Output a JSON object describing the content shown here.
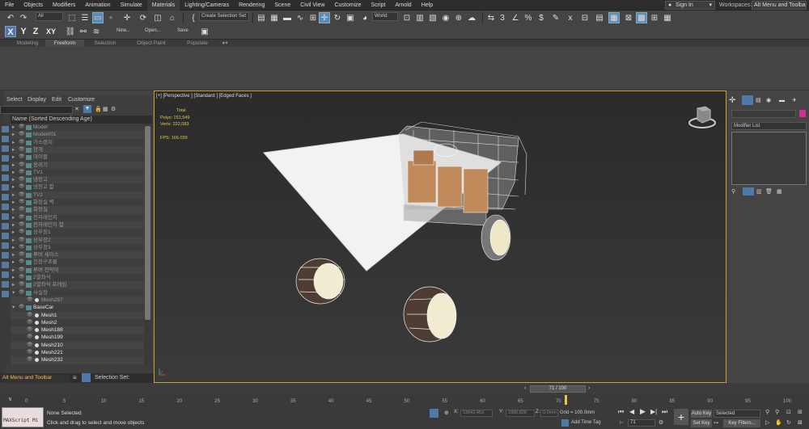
{
  "menubar": {
    "items": [
      "File",
      "Objects",
      "Modifiers",
      "Animation",
      "Simulate",
      "Materials",
      "Lighting/Cameras",
      "Rendering",
      "Scene",
      "Civil View",
      "Customize",
      "Script",
      "Arnold",
      "Help"
    ],
    "signin": "Sign In",
    "workspaces_label": "Workspaces:",
    "workspace_value": "Alt Menu and Toolbar"
  },
  "toolbar": {
    "filter": "All",
    "selection_set": "Create Selection Set",
    "coord_system": "World"
  },
  "toolbar2": {
    "axes": [
      "X",
      "Y",
      "Z",
      "XY"
    ],
    "new_label": "New...",
    "open_label": "Open...",
    "save_label": "Save"
  },
  "ribbon": {
    "tabs": [
      "Modeling",
      "Freeform",
      "Selection",
      "Object Paint",
      "Populate"
    ]
  },
  "explorer": {
    "menu": [
      "Select",
      "Display",
      "Edit",
      "Customize"
    ],
    "header": "Name (Sorted Descending Age)",
    "rows": [
      {
        "label": "Model",
        "bright": false
      },
      {
        "label": "Model001",
        "bright": false
      },
      {
        "label": "가스렌지",
        "bright": false
      },
      {
        "label": "찬개",
        "bright": false
      },
      {
        "label": "데이블",
        "bright": false
      },
      {
        "label": "옹리기",
        "bright": false
      },
      {
        "label": "TV1",
        "bright": false
      },
      {
        "label": "냉장고",
        "bright": false
      },
      {
        "label": "냉장고 함",
        "bright": false
      },
      {
        "label": "TV2",
        "bright": false
      },
      {
        "label": "화장실 벽",
        "bright": false
      },
      {
        "label": "화장실",
        "bright": false
      },
      {
        "label": "전자레인지",
        "bright": false
      },
      {
        "label": "전자레인지 함",
        "bright": false
      },
      {
        "label": "상부장1",
        "bright": false
      },
      {
        "label": "상부장2",
        "bright": false
      },
      {
        "label": "상부장3",
        "bright": false
      },
      {
        "label": "루버 세이스",
        "bright": false
      },
      {
        "label": "천장구조물",
        "bright": false
      },
      {
        "label": "루버 천막이",
        "bright": false
      },
      {
        "label": "2열좌석",
        "bright": false
      },
      {
        "label": "2열좌석 프레임",
        "bright": false
      },
      {
        "label": "사실장",
        "bright": false
      },
      {
        "label": "Mesh297",
        "bright": false
      },
      {
        "label": "BaseCar",
        "bright": true
      },
      {
        "label": "Mesh1",
        "bright": true
      },
      {
        "label": "Mesh2",
        "bright": true
      },
      {
        "label": "Mesh188",
        "bright": true
      },
      {
        "label": "Mesh199",
        "bright": true
      },
      {
        "label": "Mesh210",
        "bright": true
      },
      {
        "label": "Mesh221",
        "bright": true
      },
      {
        "label": "Mesh232",
        "bright": true
      }
    ],
    "layer": "Alt Menu and Toolbar",
    "selection_set_label": "Selection Set:"
  },
  "viewport": {
    "label": "[+] [Perspective ] [Standard ] [Edged Faces ]",
    "stats": {
      "total_label": "Total",
      "polys": "Polys:   151,549",
      "verts": "Verts:   222,083",
      "fps": "FPS:     166.039"
    }
  },
  "command_panel": {
    "modifier_list": "Modifier List"
  },
  "timeline": {
    "frame": "71 / 100",
    "ticks": [
      "0",
      "5",
      "10",
      "15",
      "20",
      "25",
      "30",
      "35",
      "40",
      "45",
      "50",
      "55",
      "60",
      "65",
      "70",
      "75",
      "80",
      "85",
      "90",
      "95",
      "100"
    ],
    "current": 71
  },
  "status": {
    "maxscript": "MAXScript Mi",
    "selected": "None Selected",
    "prompt": "Click and drag to select and move objects",
    "x_label": "X:",
    "x_value": "13542.453",
    "y_label": "Y:",
    "y_value": "2380.828",
    "z_label": "Z:",
    "z_value": "0.0mm",
    "grid": "Grid = 100.0mm",
    "add_time_tag": "Add Time Tag",
    "auto_key": "Auto Key",
    "set_key": "Set Key",
    "key_mode": "Selected",
    "key_filters": "Key Filters...",
    "current_frame": "71"
  }
}
